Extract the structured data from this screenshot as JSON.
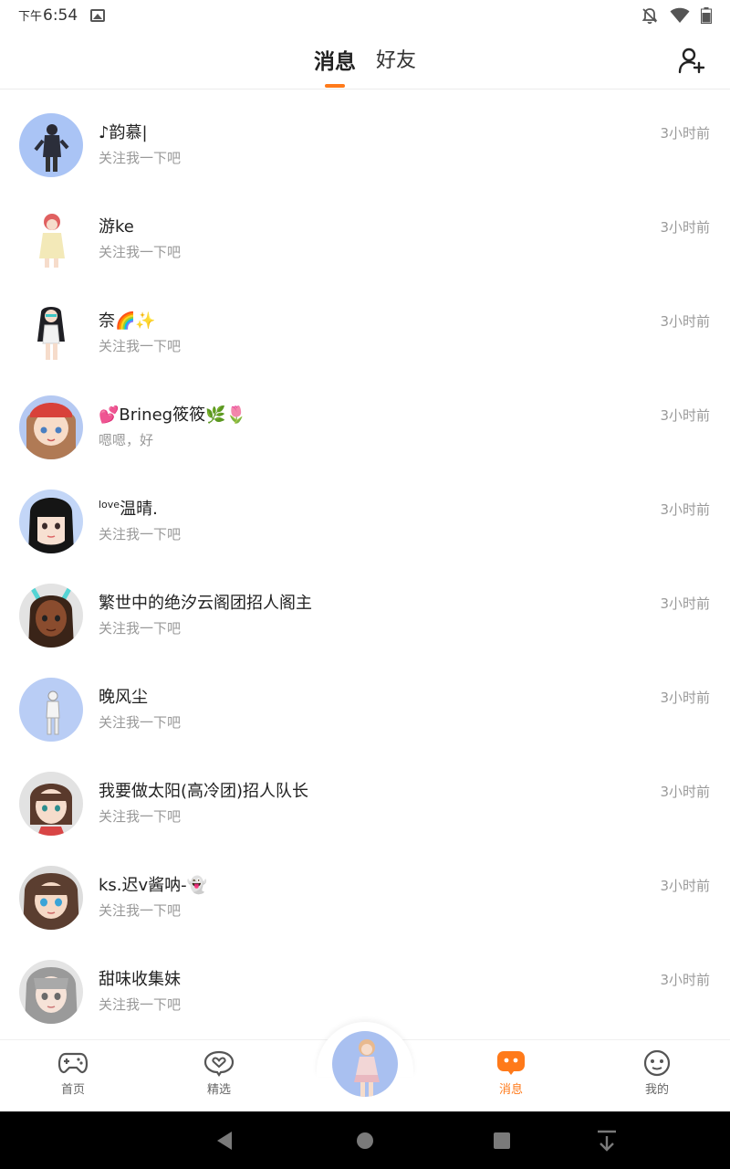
{
  "status_bar": {
    "ampm": "下午",
    "time": "6:54"
  },
  "header": {
    "tabs": [
      {
        "label": "消息",
        "active": true
      },
      {
        "label": "好友",
        "active": false
      }
    ],
    "accent_color": "#ff7a1a"
  },
  "messages": [
    {
      "name": "♪韵慕|",
      "preview": "关注我一下吧",
      "time": "3小时前"
    },
    {
      "name": "游ke",
      "preview": "关注我一下吧",
      "time": "3小时前"
    },
    {
      "name": "奈🌈✨",
      "preview": "关注我一下吧",
      "time": "3小时前"
    },
    {
      "name": "💕Brineg筱筱🌿🌷",
      "preview": "嗯嗯，好",
      "time": "3小时前"
    },
    {
      "name_sup": "love",
      "name": "温晴.",
      "preview": "关注我一下吧",
      "time": "3小时前"
    },
    {
      "name": "繁世中的绝汐云阁团招人阁主",
      "preview": "关注我一下吧",
      "time": "3小时前"
    },
    {
      "name": "晚风尘",
      "preview": "关注我一下吧",
      "time": "3小时前"
    },
    {
      "name": "我要做太阳(高冷团)招人队长",
      "preview": "关注我一下吧",
      "time": "3小时前"
    },
    {
      "name": "ks.迟v酱呐-👻",
      "preview": "关注我一下吧",
      "time": "3小时前"
    },
    {
      "name": "甜味收集妹",
      "preview": "关注我一下吧",
      "time": "3小时前"
    }
  ],
  "bottom_nav": {
    "items": [
      {
        "label": "首页",
        "icon": "gamepad-icon"
      },
      {
        "label": "精选",
        "icon": "heart-chat-icon"
      },
      {
        "label": "消息",
        "icon": "message-bubble-icon",
        "active": true
      },
      {
        "label": "我的",
        "icon": "smile-face-icon"
      }
    ]
  }
}
